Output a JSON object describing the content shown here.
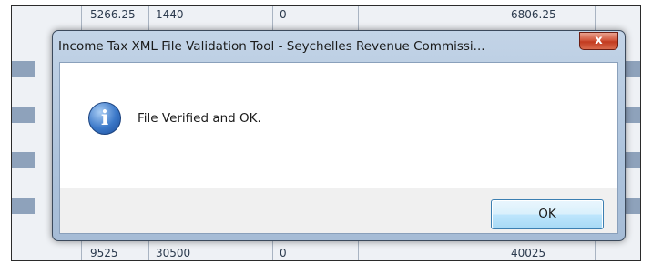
{
  "background_table": {
    "top_row": [
      "5266.25",
      "1440",
      "0",
      "6806.25"
    ],
    "bottom_row": [
      "9525",
      "30500",
      "0",
      "40025"
    ]
  },
  "dialog": {
    "title": "Income Tax XML File Validation Tool - Seychelles Revenue Commissi...",
    "close_label": "x",
    "icon": "info-icon",
    "icon_glyph": "i",
    "message": "File Verified and OK.",
    "ok_label": "OK"
  },
  "colors": {
    "titlebar": "#b3c8e0",
    "close_button": "#c9452a",
    "info_icon": "#3b78c8",
    "ok_button_border": "#3c7fb1"
  }
}
